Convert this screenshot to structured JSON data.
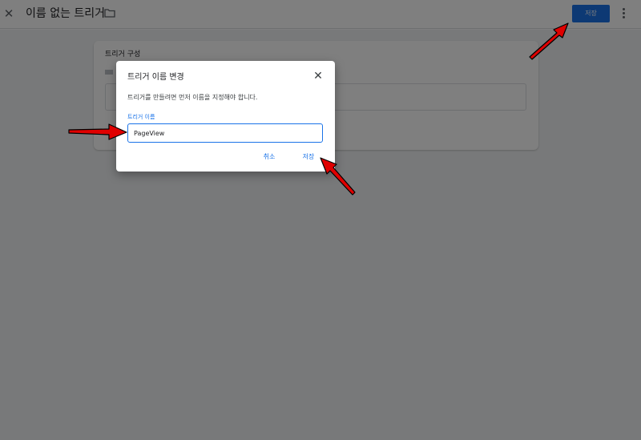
{
  "header": {
    "title": "이름 없는 트리거",
    "save_label": "저장",
    "close_icon": "close-icon",
    "folder_icon": "folder-icon",
    "more_icon": "more-vert-icon"
  },
  "config_card": {
    "title": "트리거 구성"
  },
  "dialog": {
    "title": "트리거 이름 변경",
    "message": "트리거를 만들려면 먼저 이름을 지정해야 합니다.",
    "field_label": "트리거 이름",
    "field_value": "PageView",
    "cancel_label": "취소",
    "save_label": "저장"
  },
  "colors": {
    "accent": "#1a73e8",
    "annotation_arrow": "#e00000"
  }
}
